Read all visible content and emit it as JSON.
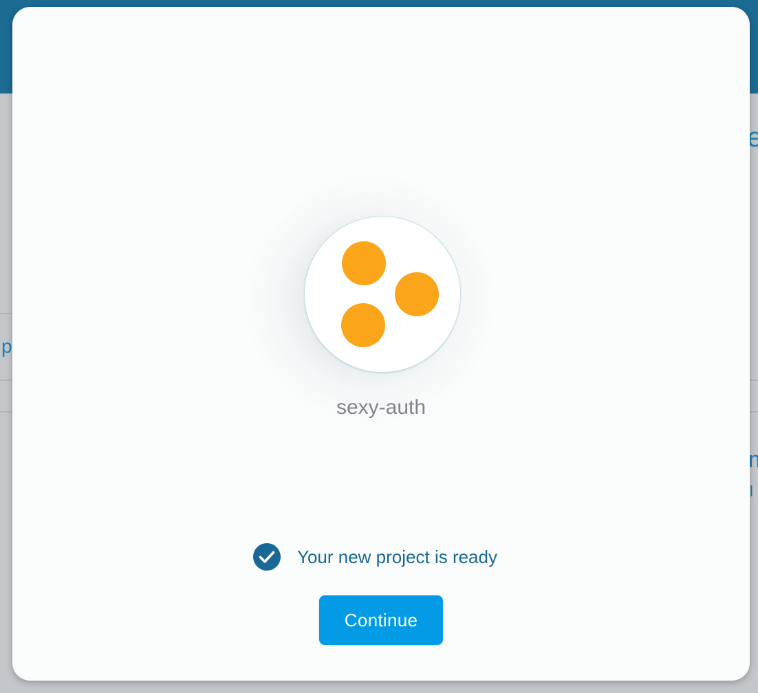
{
  "background": {
    "header_color": "#1c6b93",
    "fragments": {
      "right_top": "e",
      "left_mid": "p",
      "right_mid": "n",
      "right_small": "l"
    }
  },
  "modal": {
    "project": {
      "name": "sexy-auth",
      "avatar_icon": "project-dots-icon",
      "dot_color": "#fba51b"
    },
    "status": {
      "icon": "check-circle-icon",
      "text": "Your new project is ready",
      "color": "#1a6896"
    },
    "continue_label": "Continue",
    "accent_color": "#039be5"
  }
}
